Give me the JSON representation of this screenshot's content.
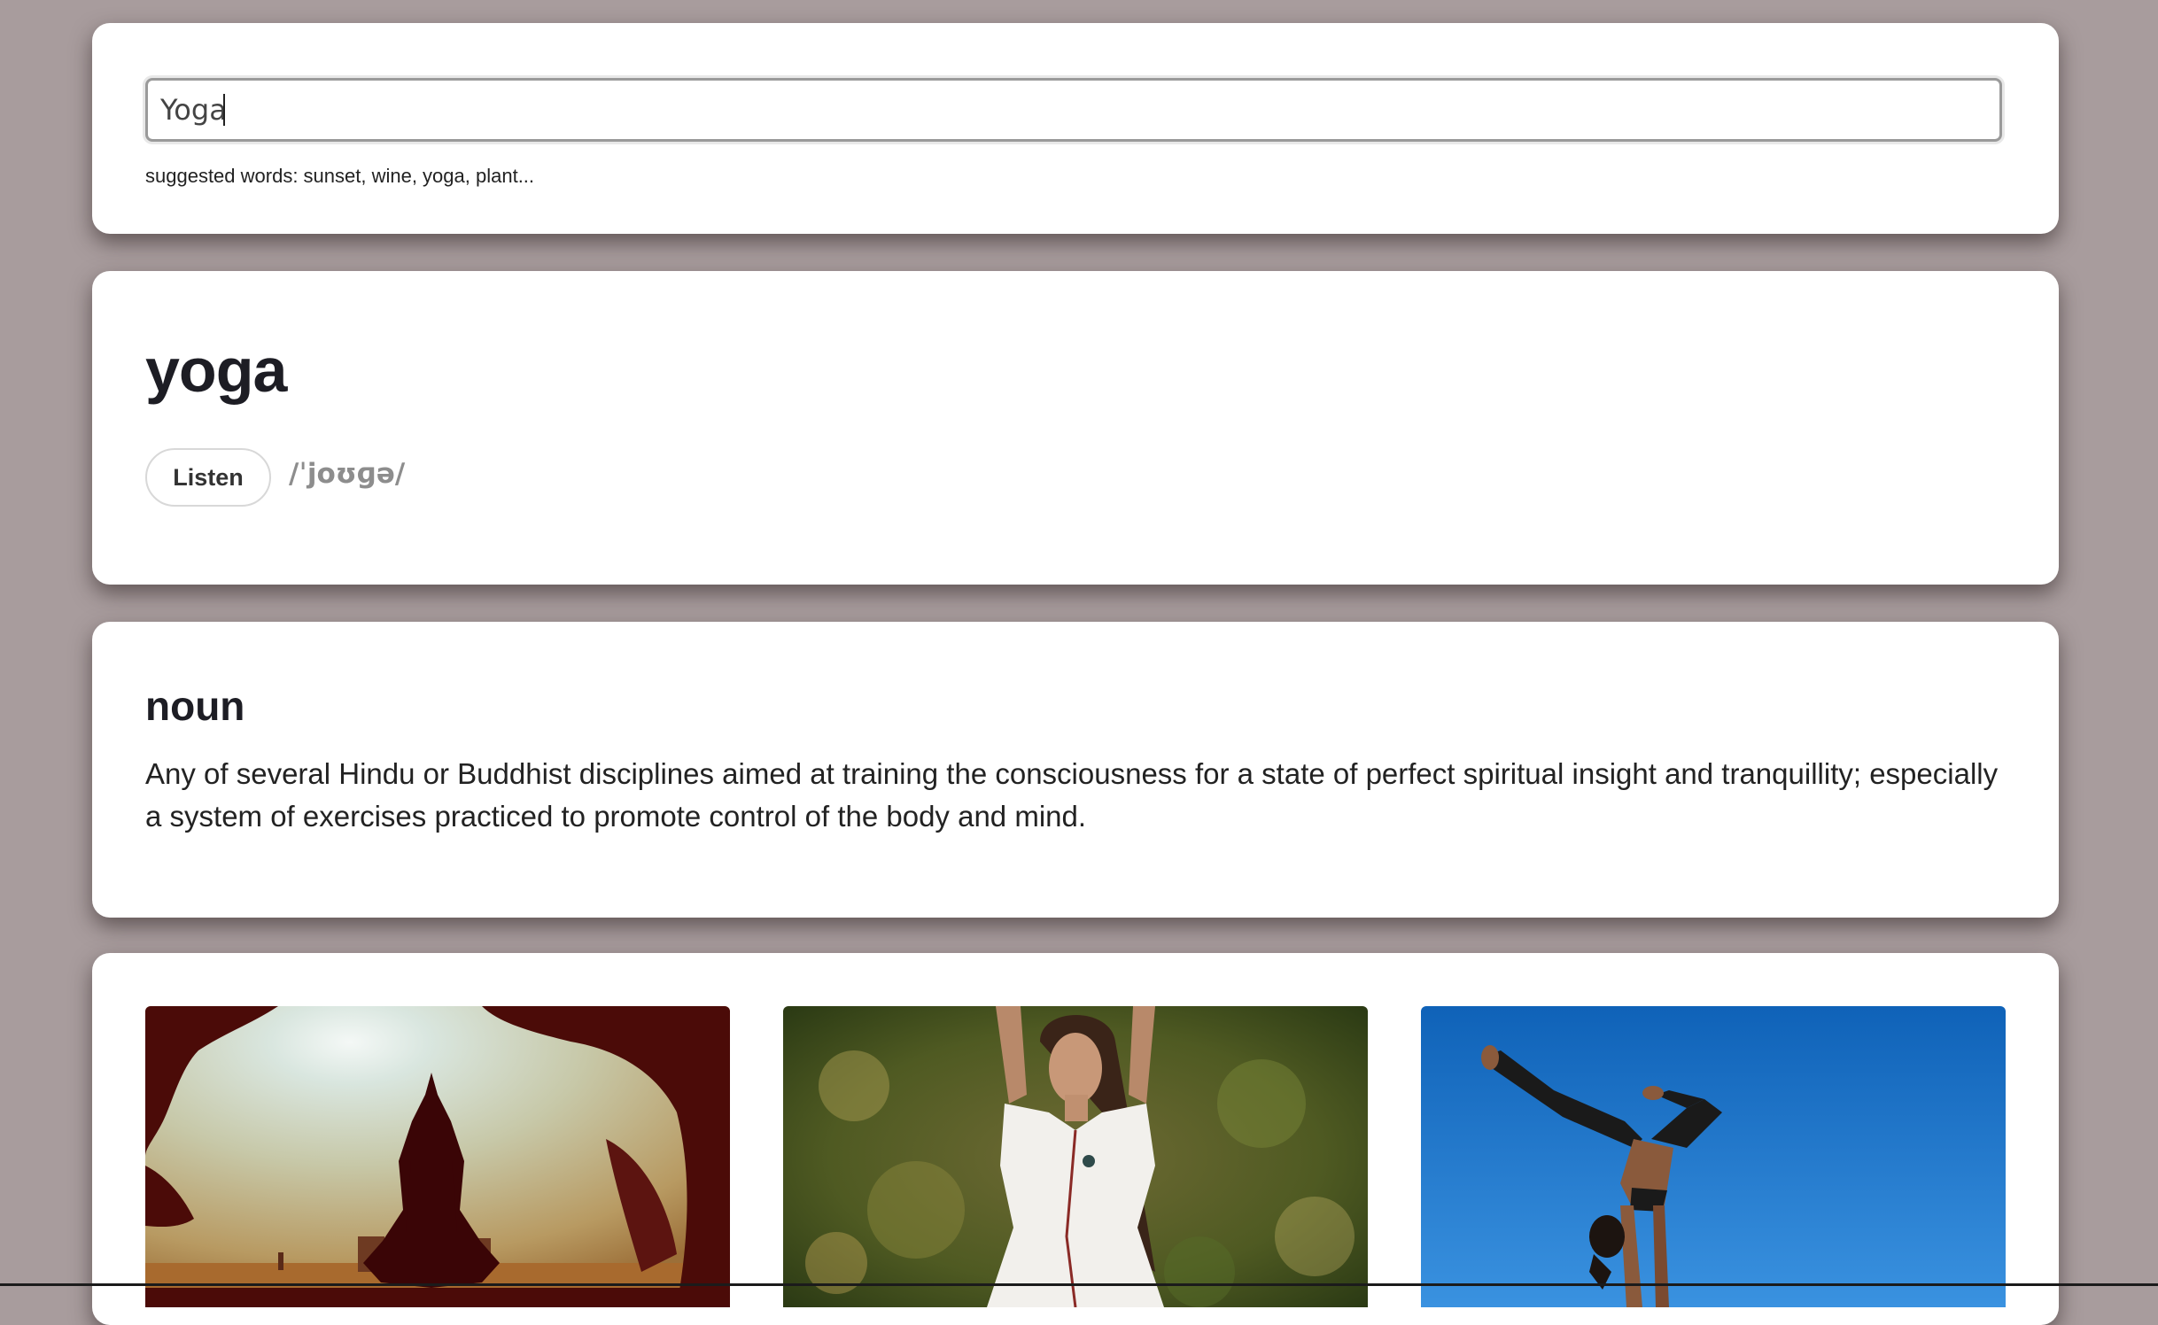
{
  "search": {
    "value": "Yoga",
    "hint": "suggested words: sunset, wine, yoga, plant..."
  },
  "word": {
    "title": "yoga",
    "listen_label": "Listen",
    "phonetic": "/ˈjoʊɡə/"
  },
  "definition": {
    "part_of_speech": "noun",
    "text": "Any of several Hindu or Buddhist disciplines aimed at training the consciousness for a state of perfect spiritual insight and tranquillity; especially a system of exercises practiced to promote control of the body and mind."
  },
  "gallery": {
    "images": [
      {
        "subject": "silhouette meditating under tree at sunset"
      },
      {
        "subject": "woman in white dress with raised arms in forest"
      },
      {
        "subject": "woman doing handstand pose against blue sky"
      }
    ]
  },
  "colors": {
    "background": "#a89c9d",
    "card": "#ffffff",
    "title": "#1d1d24",
    "phonetic": "#8d8d8d"
  }
}
